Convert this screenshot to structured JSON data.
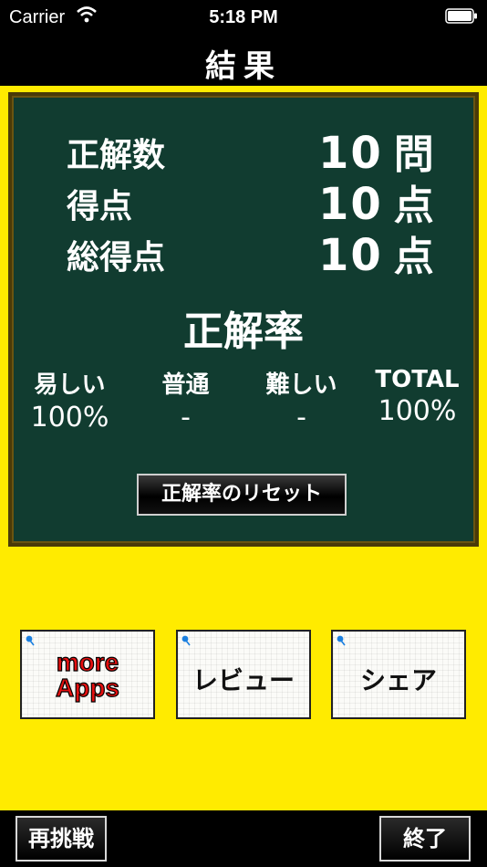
{
  "status_bar": {
    "carrier": "Carrier",
    "time": "5:18 PM"
  },
  "nav": {
    "title": "結果"
  },
  "results": [
    {
      "label": "正解数",
      "value": "10",
      "unit": "問"
    },
    {
      "label": "得点",
      "value": "10",
      "unit": "点"
    },
    {
      "label": "総得点",
      "value": "10",
      "unit": "点"
    }
  ],
  "accuracy": {
    "title": "正解率",
    "columns": [
      {
        "label": "易しい",
        "value": "100%"
      },
      {
        "label": "普通",
        "value": "-"
      },
      {
        "label": "難しい",
        "value": "-"
      },
      {
        "label": "TOTAL",
        "value": "100%"
      }
    ],
    "reset_label": "正解率のリセット"
  },
  "app_buttons": {
    "more_apps_line1": "more",
    "more_apps_line2": "Apps",
    "review_label": "レビュー",
    "share_label": "シェア"
  },
  "bottom": {
    "retry_label": "再挑戦",
    "finish_label": "終了"
  },
  "colors": {
    "background": "#ffeb00",
    "board": "#113c30",
    "more_apps_text": "#e41010"
  }
}
